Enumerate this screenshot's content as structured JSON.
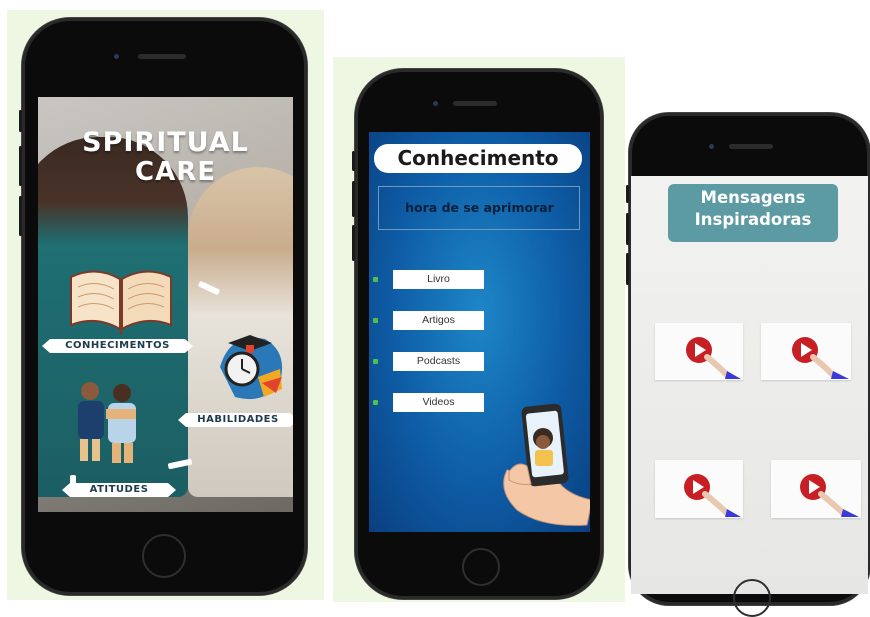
{
  "phones": [
    {
      "title_line1": "SPIRITUAL",
      "title_line2": "CARE",
      "labels": {
        "conhecimentos": "CONHECIMENTOS",
        "habilidades": "HABILIDADES",
        "atitudes": "ATITUDES"
      }
    },
    {
      "title": "Conhecimento",
      "subtitle": "hora de se aprimorar",
      "menu": [
        "Livro",
        "Artigos",
        "Podcasts",
        "Videos"
      ]
    },
    {
      "title_line1": "Mensagens",
      "title_line2": "Inspiradoras",
      "videos": [
        "play-video",
        "play-video",
        "play-video",
        "play-video"
      ]
    }
  ],
  "colors": {
    "panel_bg": "#eef7e2",
    "phone_body": "#0b0b0b",
    "screen2_blue": "#0e5da6",
    "title3_teal": "#5c9aa4",
    "play_red": "#c81f25",
    "cursor_blue": "#3a3ad8",
    "bullet_green": "#4fc04a"
  }
}
